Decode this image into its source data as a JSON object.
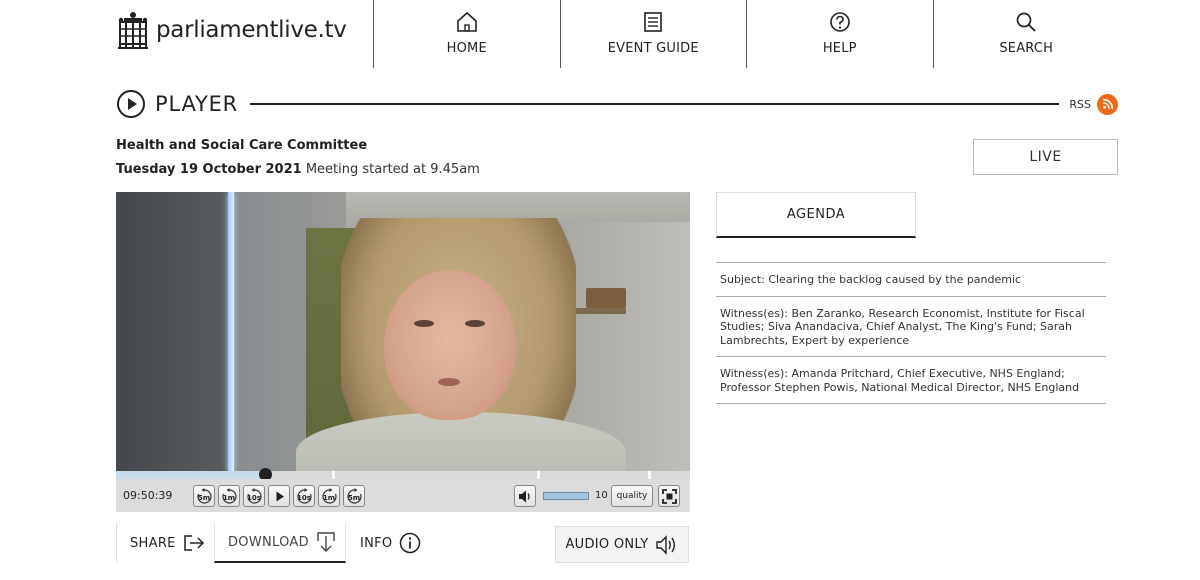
{
  "header": {
    "logo_text": "parliamentlive.tv",
    "nav": [
      {
        "label": "HOME",
        "icon": "home-icon"
      },
      {
        "label": "EVENT GUIDE",
        "icon": "document-icon"
      },
      {
        "label": "HELP",
        "icon": "help-icon"
      },
      {
        "label": "SEARCH",
        "icon": "search-icon"
      }
    ]
  },
  "player": {
    "title": "PLAYER",
    "rss_label": "RSS"
  },
  "meeting": {
    "committee": "Health and Social Care Committee",
    "date": "Tuesday 19 October 2021",
    "started": "Meeting started at 9.45am",
    "live_label": "LIVE"
  },
  "video": {
    "time": "09:50:39",
    "progress": 0.26,
    "skip_back": [
      "5m",
      "1m",
      "10s"
    ],
    "skip_forward": [
      "10s",
      "1m",
      "5m"
    ],
    "volume": "10",
    "volume_level": 1.0,
    "quality_label": "quality"
  },
  "actions": {
    "share": "SHARE",
    "download": "DOWNLOAD",
    "info": "INFO",
    "audio_only": "AUDIO ONLY"
  },
  "agenda": {
    "tab_label": "AGENDA",
    "items": [
      "Subject: Clearing the backlog caused by the pandemic",
      "Witness(es): Ben Zaranko, Research Economist, Institute for Fiscal Studies; Siva Anandaciva, Chief Analyst, The King's Fund; Sarah Lambrechts, Expert by experience",
      "Witness(es): Amanda Pritchard, Chief Executive, NHS England; Professor Stephen Powis, National Medical Director, NHS England"
    ]
  },
  "colors": {
    "rss": "#ee6a1b",
    "text": "#222222",
    "control_bar": "#dcdcdc"
  }
}
